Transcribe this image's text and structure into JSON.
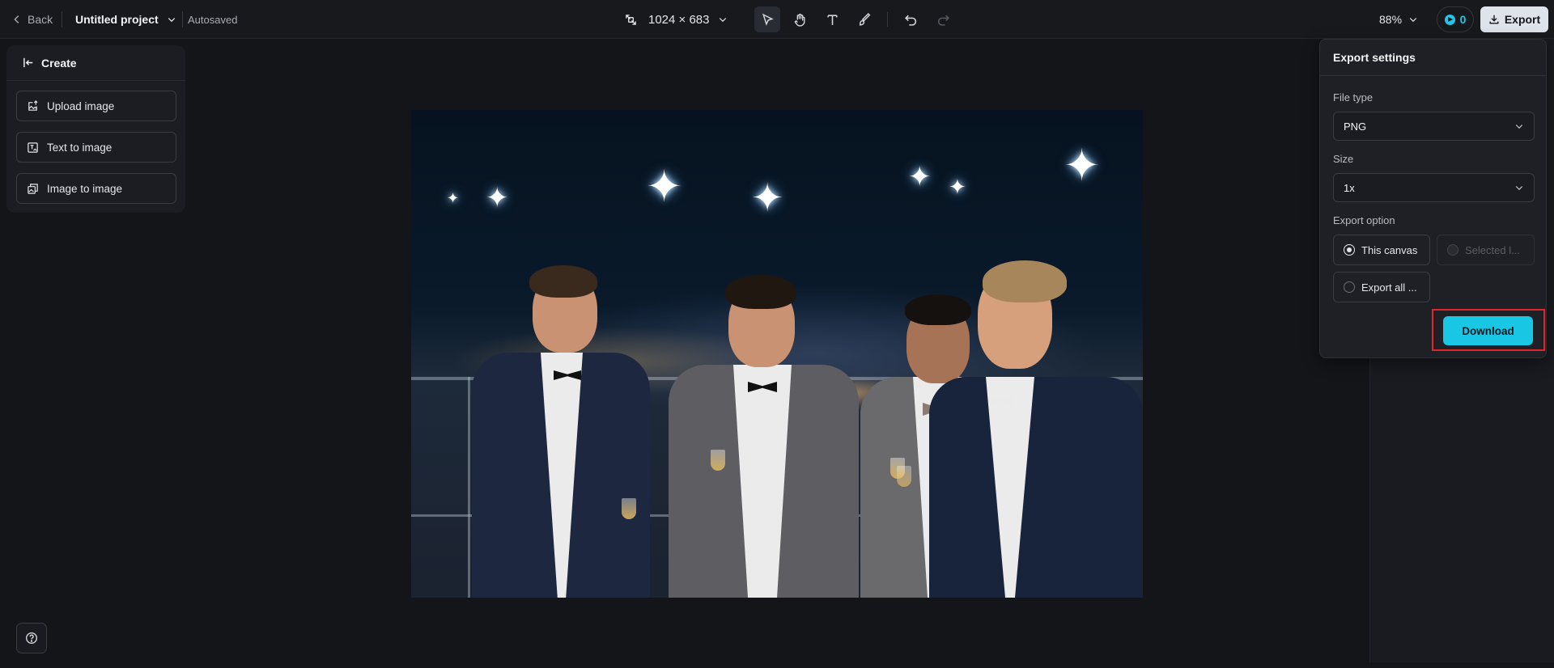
{
  "topbar": {
    "back_label": "Back",
    "project_name": "Untitled project",
    "autosave_status": "Autosaved",
    "canvas_size": "1024 × 683",
    "zoom": "88%",
    "credits": "0",
    "export_label": "Export"
  },
  "tools": [
    {
      "name": "select-tool",
      "icon": "pointer-icon",
      "active": true
    },
    {
      "name": "hand-tool",
      "icon": "hand-icon",
      "active": false
    },
    {
      "name": "text-tool",
      "icon": "text-icon",
      "active": false
    },
    {
      "name": "brush-tool",
      "icon": "brush-icon",
      "active": false
    },
    {
      "name": "undo-button",
      "icon": "undo-icon",
      "active": false
    },
    {
      "name": "redo-button",
      "icon": "redo-icon",
      "active": false,
      "disabled": true
    }
  ],
  "create_panel": {
    "title": "Create",
    "buttons": [
      {
        "label": "Upload image",
        "icon": "upload-image-icon"
      },
      {
        "label": "Text to image",
        "icon": "text-to-image-icon"
      },
      {
        "label": "Image to image",
        "icon": "image-to-image-icon"
      }
    ]
  },
  "export_settings": {
    "title": "Export settings",
    "file_type_label": "File type",
    "file_type_value": "PNG",
    "size_label": "Size",
    "size_value": "1x",
    "export_option_label": "Export option",
    "options": [
      {
        "label": "This canvas",
        "checked": true,
        "disabled": false
      },
      {
        "label": "Selected l...",
        "checked": false,
        "disabled": true
      },
      {
        "label": "Export all ...",
        "checked": false,
        "disabled": false
      }
    ],
    "download_label": "Download"
  },
  "colors": {
    "accent": "#19c6e3",
    "background": "#141519",
    "panel": "#1f2025",
    "highlight": "#e0262b"
  }
}
